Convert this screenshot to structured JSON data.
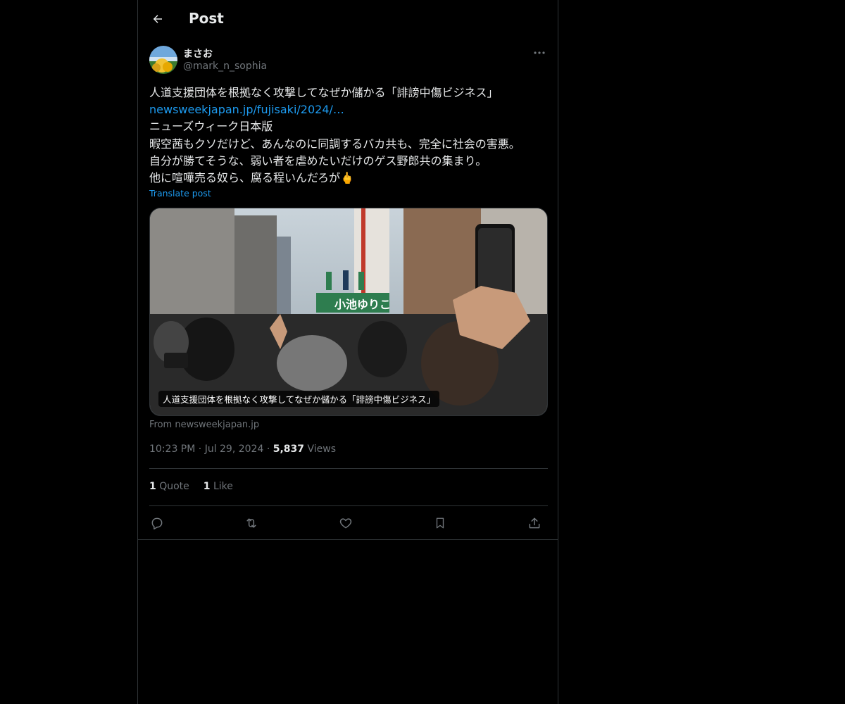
{
  "header": {
    "title": "Post"
  },
  "author": {
    "name": "まさお",
    "handle": "@mark_n_sophia"
  },
  "post": {
    "line1": "人道支援団体を根拠なく攻撃してなぜか儲かる「誹謗中傷ビジネス」",
    "link": "newsweekjapan.jp/fujisaki/2024/…",
    "line3": "ニューズウィーク日本版",
    "line4": "暇空茜もクソだけど、あんなのに同調するバカ共も、完全に社会の害悪。",
    "line5": "自分が勝てそうな、弱い者を虐めたいだけのゲス野郎共の集まり。",
    "line6": "他に喧嘩売る奴ら、腐る程いんだろが",
    "emoji": "🖕",
    "translate": "Translate post"
  },
  "media": {
    "caption": "人道支援団体を根拠なく攻撃してなぜか儲かる「誹謗中傷ビジネス」",
    "sign_text": "小池ゆりこ",
    "source": "From newsweekjapan.jp"
  },
  "meta": {
    "time": "10:23 PM",
    "sep1": "·",
    "date": "Jul 29, 2024",
    "sep2": "·",
    "views_count": "5,837",
    "views_label": "Views"
  },
  "stats": {
    "quote_count": "1",
    "quote_label": "Quote",
    "like_count": "1",
    "like_label": "Like"
  },
  "icons": {
    "back": "arrow-left-icon",
    "more": "ellipsis-icon",
    "reply": "reply-icon",
    "retweet": "retweet-icon",
    "like": "heart-icon",
    "bookmark": "bookmark-icon",
    "share": "share-icon"
  },
  "colors": {
    "background": "#000000",
    "text": "#e7e9ea",
    "muted": "#71767b",
    "accent": "#1d9bf0",
    "border": "#2f3336"
  }
}
